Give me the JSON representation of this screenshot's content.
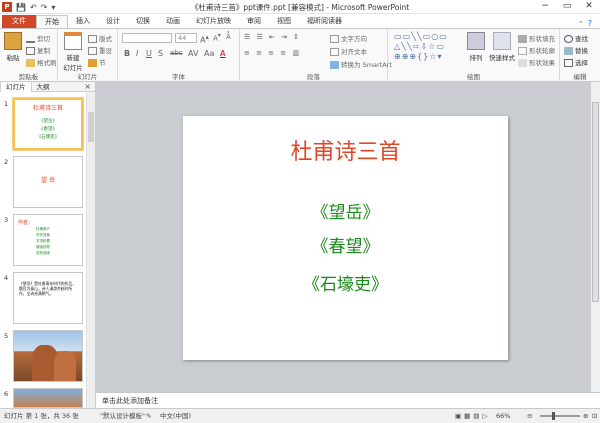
{
  "window": {
    "title": "《杜甫诗三首》ppt课件.ppt [兼容模式] - Microsoft PowerPoint",
    "app_icon": "P"
  },
  "qat": {
    "save_icon": "💾",
    "undo_icon": "↶",
    "redo_icon": "↷"
  },
  "tabs": [
    "文件",
    "开始",
    "插入",
    "设计",
    "切换",
    "动画",
    "幻灯片放映",
    "审阅",
    "视图",
    "福昕阅读器"
  ],
  "ribbon": {
    "clipboard": {
      "paste": "粘贴",
      "cut": "剪切",
      "copy": "复制",
      "format": "格式刷",
      "label": "剪贴板"
    },
    "slides": {
      "new": "新建\n幻灯片",
      "layout": "版式",
      "reset": "重设",
      "section": "节",
      "label": "幻灯片"
    },
    "font": {
      "size": "44",
      "label": "字体",
      "bold": "B",
      "italic": "I",
      "underline": "U",
      "shadow": "S",
      "strike": "abc"
    },
    "paragraph": {
      "text_direction": "文字方向",
      "align_text": "对齐文本",
      "smartart": "转换为 SmartArt",
      "label": "段落"
    },
    "drawing": {
      "arrange": "排列",
      "quick_styles": "快速样式",
      "fill": "形状填充",
      "outline": "形状轮廓",
      "effects": "形状效果",
      "label": "绘图"
    },
    "editing": {
      "find": "查找",
      "replace": "替换",
      "select": "选择",
      "label": "编辑"
    }
  },
  "left_pane": {
    "tabs": [
      "幻灯片",
      "大纲"
    ],
    "close": "×"
  },
  "thumbs": [
    {
      "num": "1",
      "title": "杜甫诗三首",
      "items": [
        "《望岳》",
        "《春望》",
        "《石壕吏》"
      ]
    },
    {
      "num": "2",
      "title": "望  岳"
    },
    {
      "num": "3",
      "title": "作者：",
      "items": [
        "杜甫简介",
        "写作背景",
        "字词积累",
        "朗读指导",
        "赏析品味"
      ]
    },
    {
      "num": "4",
      "text": "《望岳》是杜甫青年时代的作品，题目为泰山，诗人漫游齐赵时所作，全诗充满朝气。"
    },
    {
      "num": "5"
    },
    {
      "num": "6"
    }
  ],
  "slide": {
    "title": "杜甫诗三首",
    "items": [
      "《望岳》",
      "《春望》",
      "《石壕吏》"
    ]
  },
  "notes": {
    "placeholder": "单击此处添加备注"
  },
  "status": {
    "slide_info": "幻灯片 第 1 张，共 36 张",
    "theme": "\"默认设计模板\"",
    "language": "中文(中国)",
    "zoom": "66%"
  },
  "colors": {
    "file_tab": "#d24726",
    "title_red": "#e34627",
    "item_green": "#1e8a1e",
    "canvas": "#c9ccd1"
  }
}
